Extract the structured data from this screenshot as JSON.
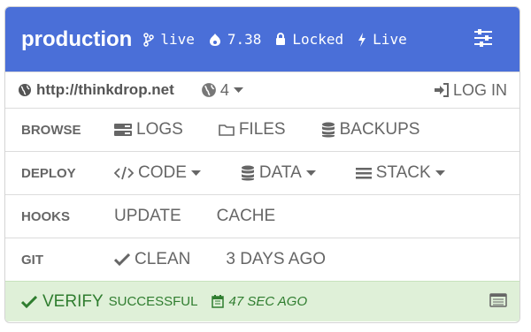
{
  "header": {
    "environment": "production",
    "branch": "live",
    "version": "7.38",
    "lock_status": "Locked",
    "power_status": "Live",
    "background_color": "#4a6fd8"
  },
  "site": {
    "url": "http://thinkdrop.net",
    "sites_count": "4",
    "login_label": "LOG IN"
  },
  "browse": {
    "label": "BROWSE",
    "logs": "LOGS",
    "files": "FILES",
    "backups": "BACKUPS"
  },
  "deploy": {
    "label": "DEPLOY",
    "code": "CODE",
    "data": "DATA",
    "stack": "STACK"
  },
  "hooks": {
    "label": "HOOKS",
    "update": "UPDATE",
    "cache": "CACHE"
  },
  "git": {
    "label": "GIT",
    "status": "CLEAN",
    "last_change": "3 DAYS AGO"
  },
  "footer": {
    "task": "VERIFY",
    "result": "SUCCESSFUL",
    "time_ago": "47 SEC AGO",
    "background_color": "#dff0d8",
    "text_color": "#2f7d2f"
  }
}
